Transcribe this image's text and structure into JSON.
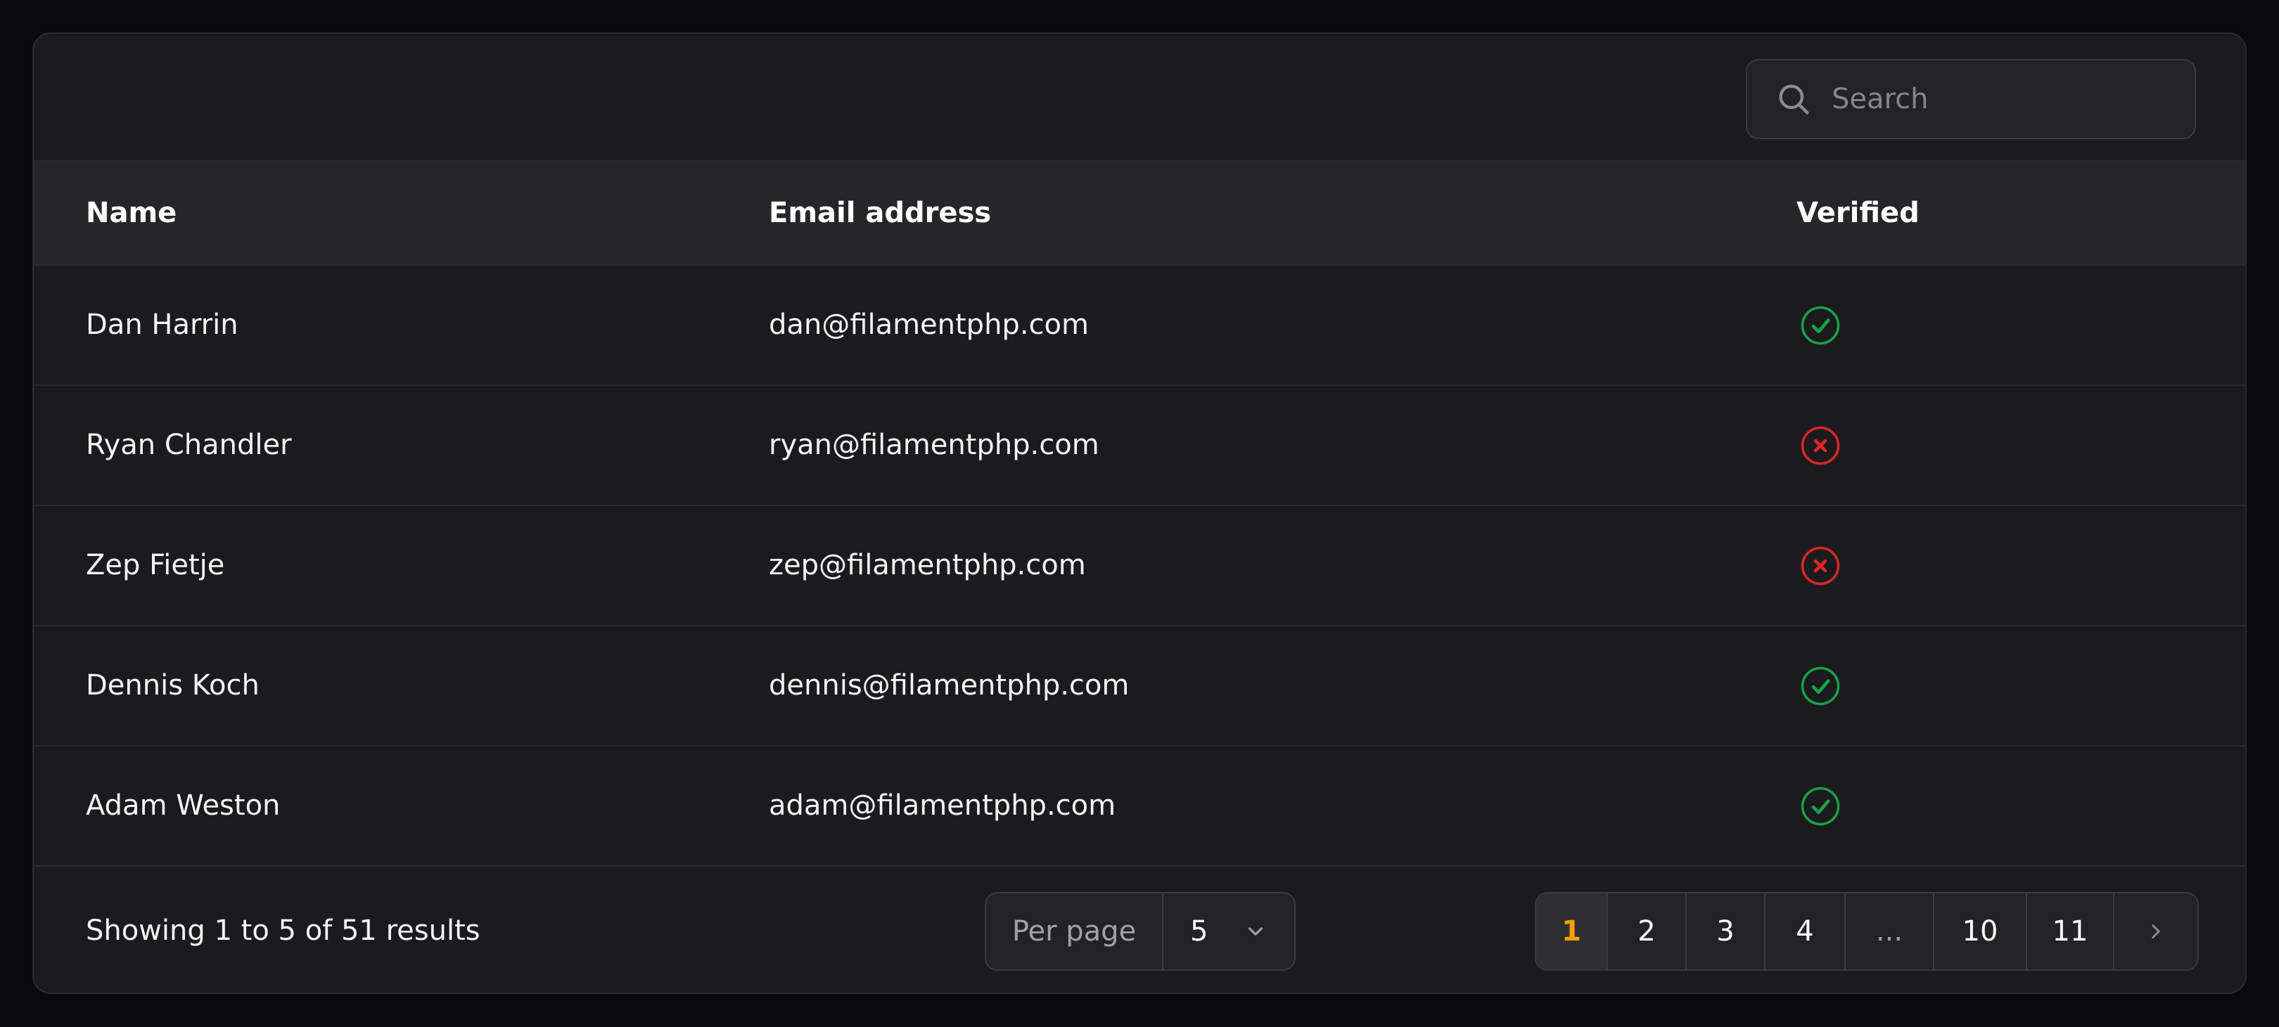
{
  "search": {
    "placeholder": "Search"
  },
  "columns": {
    "name": "Name",
    "email": "Email address",
    "verified": "Verified"
  },
  "rows": [
    {
      "name": "Dan Harrin",
      "email": "dan@filamentphp.com",
      "verified": true
    },
    {
      "name": "Ryan Chandler",
      "email": "ryan@filamentphp.com",
      "verified": false
    },
    {
      "name": "Zep Fietje",
      "email": "zep@filamentphp.com",
      "verified": false
    },
    {
      "name": "Dennis Koch",
      "email": "dennis@filamentphp.com",
      "verified": true
    },
    {
      "name": "Adam Weston",
      "email": "adam@filamentphp.com",
      "verified": true
    }
  ],
  "footer": {
    "results_text": "Showing 1 to 5 of 51 results",
    "per_page_label": "Per page",
    "per_page_value": "5"
  },
  "pagination": {
    "pages": [
      "1",
      "2",
      "3",
      "4",
      "...",
      "10",
      "11"
    ],
    "active": "1"
  },
  "colors": {
    "verified_true": "#16a34a",
    "verified_false": "#dc2626",
    "active_page": "#f59e0b"
  },
  "icons": {
    "search": "search-icon",
    "verified_true": "check-circle-icon",
    "verified_false": "x-circle-icon",
    "per_page_dropdown": "chevron-down-icon",
    "next_page": "chevron-right-icon"
  }
}
